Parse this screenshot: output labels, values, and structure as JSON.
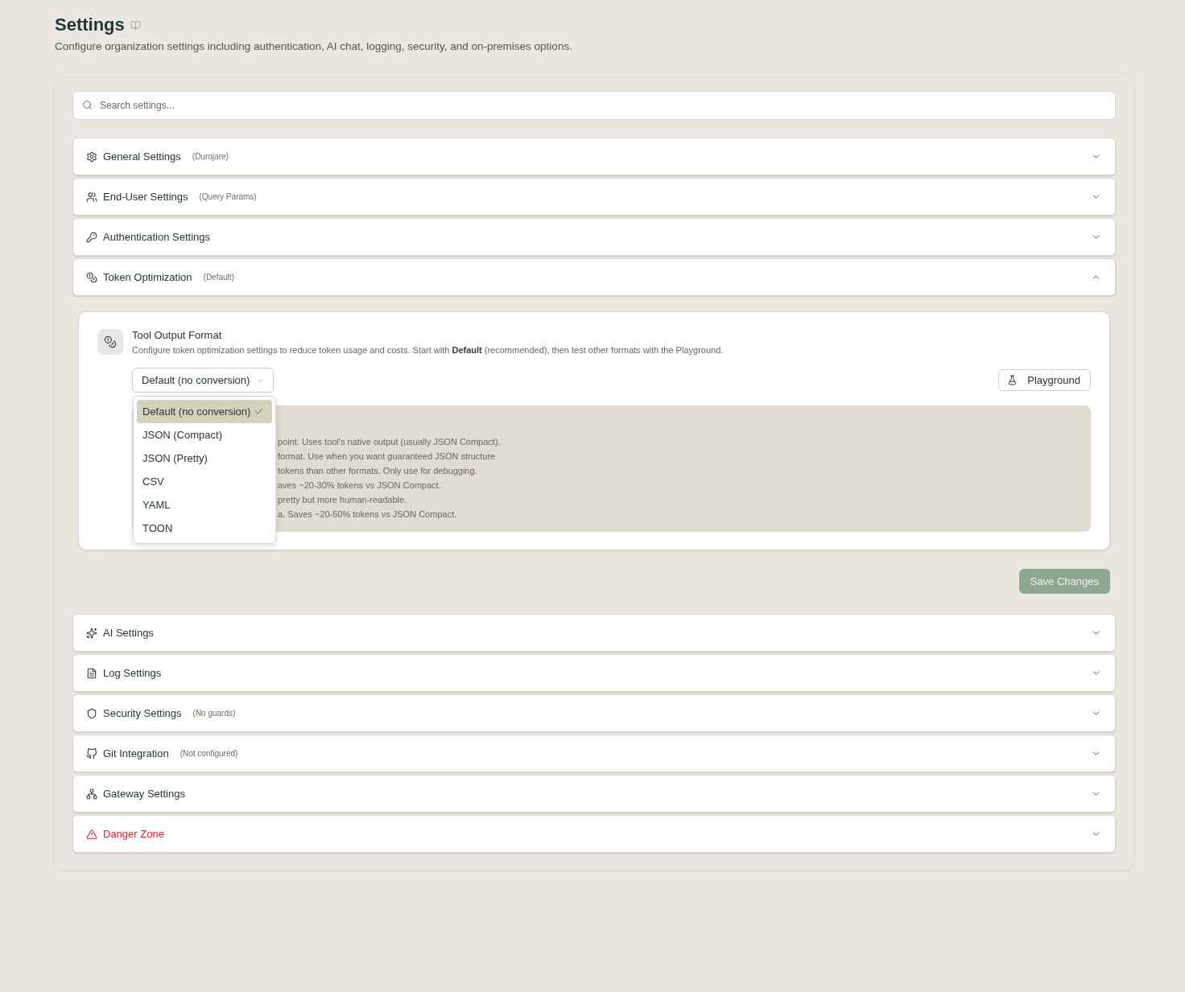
{
  "page": {
    "title": "Settings",
    "subtitle": "Configure organization settings including authentication, AI chat, logging, security, and on-premises options."
  },
  "search": {
    "placeholder": "Search settings..."
  },
  "sections": [
    {
      "label": "General Settings",
      "badge": "(Durojare)",
      "kind": "normal",
      "expanded": false
    },
    {
      "label": "End-User Settings",
      "badge": "(Query Params)",
      "kind": "normal",
      "expanded": false
    },
    {
      "label": "Authentication Settings",
      "kind": "normal",
      "expanded": false
    },
    {
      "label": "Token Optimization",
      "badge": "(Default)",
      "kind": "normal",
      "expanded": true,
      "panel": {
        "title": "Tool Output Format",
        "description": "Configure token optimization settings to reduce token usage and costs. Start with **Default** (recommended), then test other formats with the Playground.",
        "select": {
          "value": "Default (no conversion)",
          "open": true,
          "options": [
            {
              "label": "Default (no conversion)",
              "selected": true
            },
            {
              "label": "JSON (Compact)",
              "selected": false
            },
            {
              "label": "JSON (Pretty)",
              "selected": false
            },
            {
              "label": "CSV",
              "selected": false
            },
            {
              "label": "YAML",
              "selected": false
            },
            {
              "label": "TOON",
              "selected": false
            }
          ]
        },
        "playground_button": "Playground",
        "info_lines": [
          "point. Uses tool's native output (usually JSON Compact).",
          "format. Use when you want guaranteed JSON structure",
          "tokens than other formats. Only use for debugging.",
          "aves ~20-30% tokens vs JSON Compact.",
          "pretty but more human-readable.",
          "a. Saves ~20-50% tokens vs JSON Compact."
        ],
        "save_button": {
          "label": "Save Changes",
          "disabled": true
        }
      }
    },
    {
      "label": "AI Settings",
      "kind": "normal",
      "expanded": false
    },
    {
      "label": "Log Settings",
      "kind": "normal",
      "expanded": false
    },
    {
      "label": "Security Settings",
      "badge": "(No guards)",
      "kind": "normal",
      "expanded": false
    },
    {
      "label": "Git Integration",
      "badge": "(Not configured)",
      "kind": "normal",
      "expanded": false
    },
    {
      "label": "Gateway Settings",
      "kind": "normal",
      "expanded": false
    },
    {
      "label": "Danger Zone",
      "kind": "danger",
      "expanded": false
    }
  ]
}
